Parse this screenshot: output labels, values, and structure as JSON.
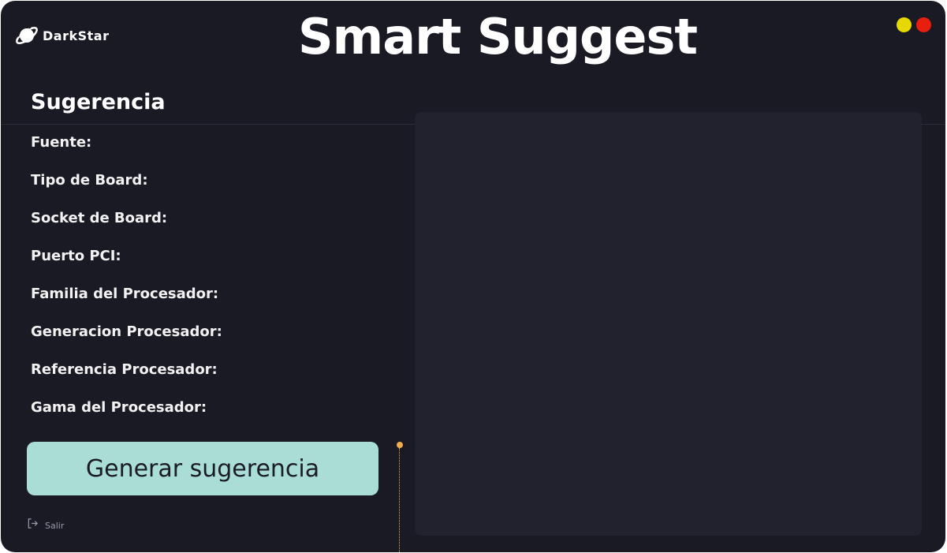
{
  "header": {
    "brand": "DarkStar",
    "title": "Smart Suggest"
  },
  "window_controls": {
    "minimize_color": "#e6d800",
    "close_color": "#e81e0e"
  },
  "section": {
    "title": "Sugerencia"
  },
  "fields": [
    {
      "label": "Fuente:"
    },
    {
      "label": "Tipo de Board:"
    },
    {
      "label": "Socket de Board:"
    },
    {
      "label": "Puerto PCI:"
    },
    {
      "label": "Familia del Procesador:"
    },
    {
      "label": "Generacion Procesador:"
    },
    {
      "label": "Referencia Procesador:"
    },
    {
      "label": "Gama del Procesador:"
    }
  ],
  "actions": {
    "generate_label": "Generar sugerencia",
    "exit_label": "Salir"
  },
  "icons": {
    "logo": "planet-icon",
    "exit": "logout-icon"
  },
  "colors": {
    "background": "#1a1a24",
    "panel": "#22222e",
    "accent_button": "#a9ddd6",
    "splitter": "#f0ad4e"
  }
}
